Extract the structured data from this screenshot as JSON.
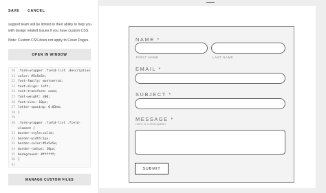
{
  "toolbar": {
    "save_label": "SAVE",
    "cancel_label": "CANCEL"
  },
  "sidebar": {
    "info_text": "support team will be limited in their ability to help you with design related issues if you have custom CSS.",
    "note_text": "Note: Custom CSS does not apply to Cover Pages.",
    "open_window_label": "OPEN IN WINDOW",
    "manage_files_label": "MANAGE CUSTOM FILES"
  },
  "code_lines": [
    {
      "num": "20",
      "text": ".form-wrapper .field-list .description {"
    },
    {
      "num": "21",
      "text": "color: #5e5e5e;"
    },
    {
      "num": "22",
      "text": "font-family: montserrat;"
    },
    {
      "num": "23",
      "text": "text-align: left;"
    },
    {
      "num": "24",
      "text": "text-transform: none;"
    },
    {
      "num": "25",
      "text": "font-weight: 300;"
    },
    {
      "num": "26",
      "text": "font-size: 10px;"
    },
    {
      "num": "27",
      "text": "letter-spacing: 0.03em;"
    },
    {
      "num": "28",
      "text": "}"
    },
    {
      "num": "29",
      "text": ""
    },
    {
      "num": "30",
      "text": ".form-wrapper .field-list .field-"
    },
    {
      "num": "",
      "text": "element {"
    },
    {
      "num": "31",
      "text": "border-style:solid;"
    },
    {
      "num": "32",
      "text": "border-width:1px;"
    },
    {
      "num": "33",
      "text": "border-color:#5e5e5e;"
    },
    {
      "num": "34",
      "text": "border-radius: 20px;"
    },
    {
      "num": "35",
      "text": "background: #ffffff;"
    },
    {
      "num": "36",
      "text": "}"
    },
    {
      "num": "41",
      "text": ""
    }
  ],
  "form": {
    "name_label": "NAME *",
    "first_name_label": "FIRST NAME",
    "last_name_label": "LAST NAME",
    "email_label": "EMAIL *",
    "subject_label": "SUBJECT *",
    "message_label": "MESSAGE *",
    "message_description": "Here is a description.",
    "submit_label": "SUBMIT"
  }
}
